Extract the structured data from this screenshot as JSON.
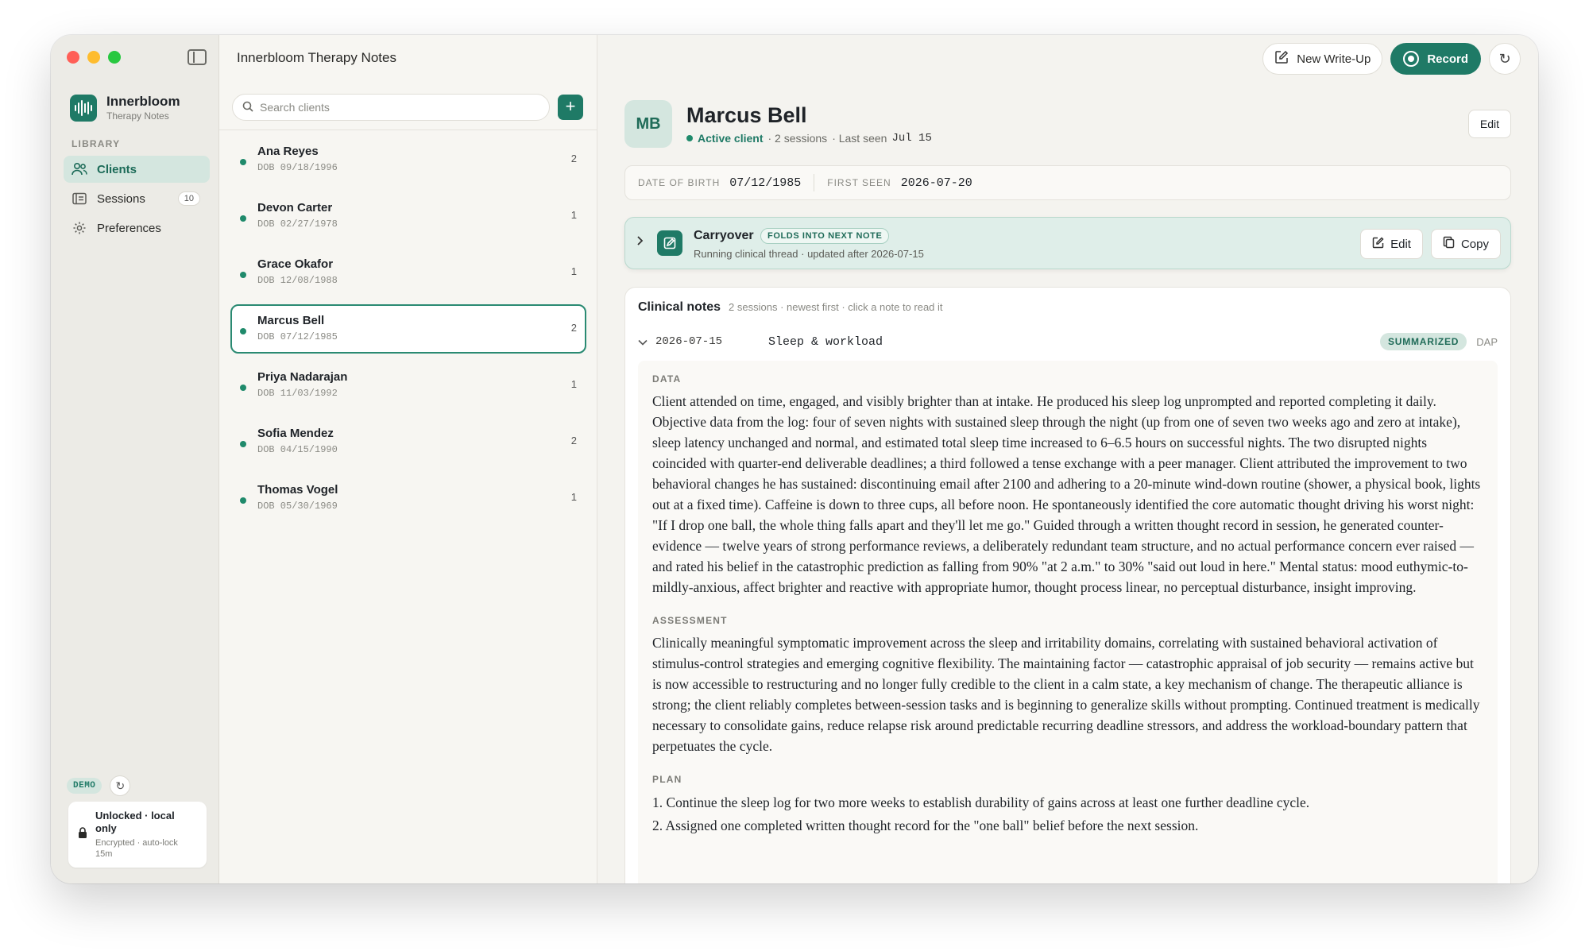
{
  "sidebar": {
    "brand_name": "Innerbloom",
    "brand_sub": "Therapy Notes",
    "library_label": "LIBRARY",
    "items": [
      {
        "label": "Clients",
        "icon": "users-icon",
        "active": true
      },
      {
        "label": "Sessions",
        "icon": "sessions-icon",
        "badge": "10"
      },
      {
        "label": "Preferences",
        "icon": "gear-icon"
      }
    ],
    "demo_label": "DEMO",
    "lock_title": "Unlocked · local only",
    "lock_sub": "Encrypted · auto-lock 15m"
  },
  "list": {
    "app_title": "Innerbloom Therapy Notes",
    "search_placeholder": "Search clients",
    "add_label": "+",
    "clients": [
      {
        "name": "Ana Reyes",
        "dob": "DOB 09/18/1996",
        "count": "2"
      },
      {
        "name": "Devon Carter",
        "dob": "DOB 02/27/1978",
        "count": "1"
      },
      {
        "name": "Grace Okafor",
        "dob": "DOB 12/08/1988",
        "count": "1"
      },
      {
        "name": "Marcus Bell",
        "dob": "DOB 07/12/1985",
        "count": "2",
        "active": true
      },
      {
        "name": "Priya Nadarajan",
        "dob": "DOB 11/03/1992",
        "count": "1"
      },
      {
        "name": "Sofia Mendez",
        "dob": "DOB 04/15/1990",
        "count": "2"
      },
      {
        "name": "Thomas Vogel",
        "dob": "DOB 05/30/1969",
        "count": "1"
      }
    ]
  },
  "toolbar": {
    "new_writeup": "New Write-Up",
    "record": "Record"
  },
  "client": {
    "initials": "MB",
    "name": "Marcus Bell",
    "status": "Active client",
    "sessions": "· 2 sessions",
    "last_seen_label": "· Last seen",
    "last_seen": "Jul 15",
    "edit": "Edit",
    "dob_label": "DATE OF BIRTH",
    "dob": "07/12/1985",
    "first_seen_label": "FIRST SEEN",
    "first_seen": "2026-07-20"
  },
  "carryover": {
    "title": "Carryover",
    "tag": "FOLDS INTO NEXT NOTE",
    "sub": "Running clinical thread · updated after 2026-07-15",
    "edit": "Edit",
    "copy": "Copy"
  },
  "notes": {
    "title": "Clinical notes",
    "sub": "2 sessions · newest first · click a note to read it",
    "entry": {
      "date": "2026-07-15",
      "topic": "Sleep & workload",
      "status": "SUMMARIZED",
      "format": "DAP",
      "data_label": "DATA",
      "data_text": "Client attended on time, engaged, and visibly brighter than at intake. He produced his sleep log unprompted and reported completing it daily. Objective data from the log: four of seven nights with sustained sleep through the night (up from one of seven two weeks ago and zero at intake), sleep latency unchanged and normal, and estimated total sleep time increased to 6–6.5 hours on successful nights. The two disrupted nights coincided with quarter-end deliverable deadlines; a third followed a tense exchange with a peer manager. Client attributed the improvement to two behavioral changes he has sustained: discontinuing email after 2100 and adhering to a 20-minute wind-down routine (shower, a physical book, lights out at a fixed time). Caffeine is down to three cups, all before noon. He spontaneously identified the core automatic thought driving his worst night: \"If I drop one ball, the whole thing falls apart and they'll let me go.\" Guided through a written thought record in session, he generated counter-evidence — twelve years of strong performance reviews, a deliberately redundant team structure, and no actual performance concern ever raised — and rated his belief in the catastrophic prediction as falling from 90% \"at 2 a.m.\" to 30% \"said out loud in here.\" Mental status: mood euthymic-to-mildly-anxious, affect brighter and reactive with appropriate humor, thought process linear, no perceptual disturbance, insight improving.",
      "assessment_label": "ASSESSMENT",
      "assessment_text": "Clinically meaningful symptomatic improvement across the sleep and irritability domains, correlating with sustained behavioral activation of stimulus-control strategies and emerging cognitive flexibility. The maintaining factor — catastrophic appraisal of job security — remains active but is now accessible to restructuring and no longer fully credible to the client in a calm state, a key mechanism of change. The therapeutic alliance is strong; the client reliably completes between-session tasks and is beginning to generalize skills without prompting. Continued treatment is medically necessary to consolidate gains, reduce relapse risk around predictable recurring deadline stressors, and address the workload-boundary pattern that perpetuates the cycle.",
      "plan_label": "PLAN",
      "plan_items": [
        "1. Continue the sleep log for two more weeks to establish durability of gains across at least one further deadline cycle.",
        "2. Assigned one completed written thought record for the \"one ball\" belief before the next session."
      ]
    }
  },
  "colors": {
    "accent": "#1f7a66",
    "accent_soft": "#d4e6df"
  }
}
